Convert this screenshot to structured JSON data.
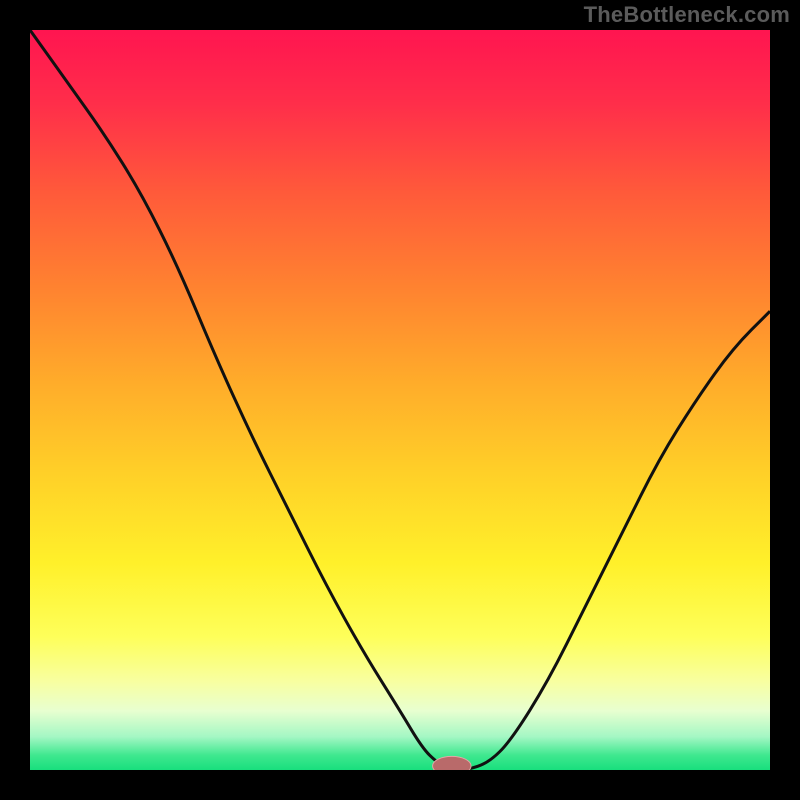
{
  "watermark": "TheBottleneck.com",
  "colors": {
    "frame": "#000000",
    "watermark": "#5b5b5b",
    "curve": "#111111",
    "marker_fill": "#b96a6a",
    "marker_stroke": "#e2a7a7",
    "gradient_stops": [
      {
        "offset": 0.0,
        "color": "#ff1550"
      },
      {
        "offset": 0.1,
        "color": "#ff2e4a"
      },
      {
        "offset": 0.22,
        "color": "#ff5a3a"
      },
      {
        "offset": 0.35,
        "color": "#ff8330"
      },
      {
        "offset": 0.48,
        "color": "#ffad2a"
      },
      {
        "offset": 0.6,
        "color": "#ffd028"
      },
      {
        "offset": 0.72,
        "color": "#fff02a"
      },
      {
        "offset": 0.82,
        "color": "#feff5a"
      },
      {
        "offset": 0.88,
        "color": "#f8ffa0"
      },
      {
        "offset": 0.92,
        "color": "#e8ffd0"
      },
      {
        "offset": 0.955,
        "color": "#a4f7c4"
      },
      {
        "offset": 0.98,
        "color": "#3fe88f"
      },
      {
        "offset": 1.0,
        "color": "#18df7d"
      }
    ]
  },
  "chart_data": {
    "type": "line",
    "title": "",
    "xlabel": "",
    "ylabel": "",
    "xlim": [
      0,
      100
    ],
    "ylim": [
      0,
      100
    ],
    "grid": false,
    "legend": false,
    "optimum_x": 57,
    "series": [
      {
        "name": "bottleneck-curve",
        "x": [
          0,
          5,
          10,
          15,
          20,
          25,
          30,
          35,
          40,
          45,
          50,
          53,
          55,
          57,
          59,
          62,
          65,
          70,
          75,
          80,
          85,
          90,
          95,
          100
        ],
        "y": [
          100,
          93,
          86,
          78,
          68,
          56,
          45,
          35,
          25,
          16,
          8,
          3,
          1,
          0,
          0,
          1,
          4,
          12,
          22,
          32,
          42,
          50,
          57,
          62
        ]
      }
    ],
    "marker": {
      "x": 57,
      "y": 0,
      "rx": 2.6,
      "ry": 1.3
    }
  }
}
